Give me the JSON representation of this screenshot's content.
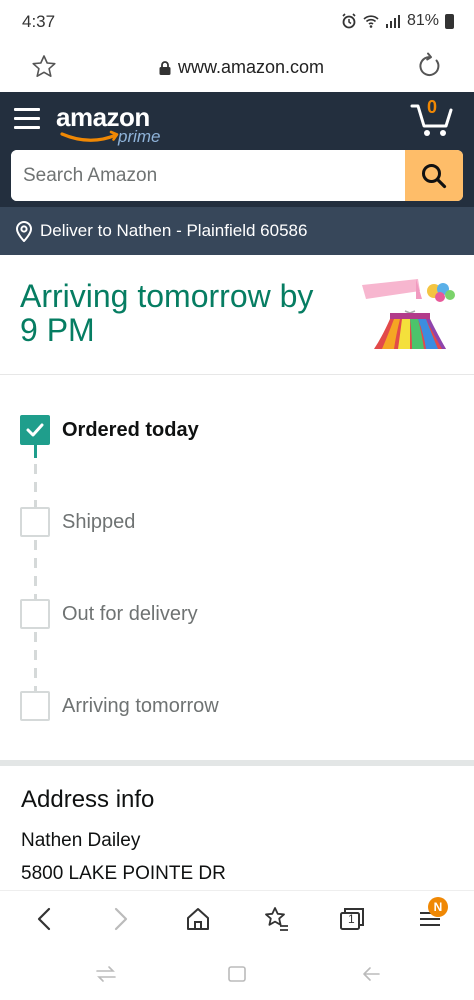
{
  "status_bar": {
    "time": "4:37",
    "battery": "81%"
  },
  "browser": {
    "url": "www.amazon.com"
  },
  "header": {
    "logo_text": "amazon",
    "logo_sub": "prime",
    "cart_count": "0",
    "search_placeholder": "Search Amazon",
    "deliver_to": "Deliver to Nathen - Plainfield 60586"
  },
  "arrival": {
    "title": "Arriving tomorrow by 9 PM"
  },
  "tracker": {
    "steps": [
      {
        "label": "Ordered today",
        "done": true
      },
      {
        "label": "Shipped",
        "done": false
      },
      {
        "label": "Out for delivery",
        "done": false
      },
      {
        "label": "Arriving tomorrow",
        "done": false
      }
    ]
  },
  "address": {
    "title": "Address info",
    "name": "Nathen Dailey",
    "street": "5800 LAKE POINTE DR"
  },
  "browser_nav": {
    "tabs_count": "1",
    "menu_badge": "N"
  },
  "colors": {
    "header_bg": "#232f3e",
    "deliver_bg": "#37475a",
    "accent_teal": "#067d62",
    "check_teal": "#1f9e8c",
    "search_btn": "#febd69",
    "cart_orange": "#f08804"
  }
}
